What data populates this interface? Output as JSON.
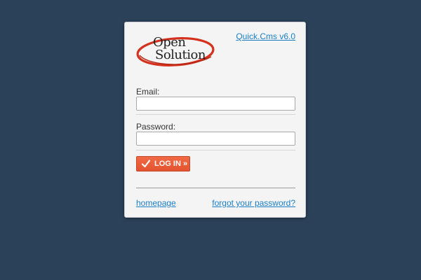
{
  "logo": {
    "line1": "Open",
    "line2": "Solution",
    "swoosh_color": "#d4321e"
  },
  "header": {
    "version_link": "Quick.Cms v6.0"
  },
  "form": {
    "email_label": "Email:",
    "email_value": "",
    "password_label": "Password:",
    "password_value": "",
    "login_button": "LOG IN »"
  },
  "footer": {
    "homepage_link": "homepage",
    "forgot_link": "forgot your password?"
  },
  "colors": {
    "background": "#2b4159",
    "panel": "#f4f4f4",
    "link": "#1a7fc4",
    "button": "#e95c38"
  },
  "icons": {
    "login": "check-icon"
  }
}
